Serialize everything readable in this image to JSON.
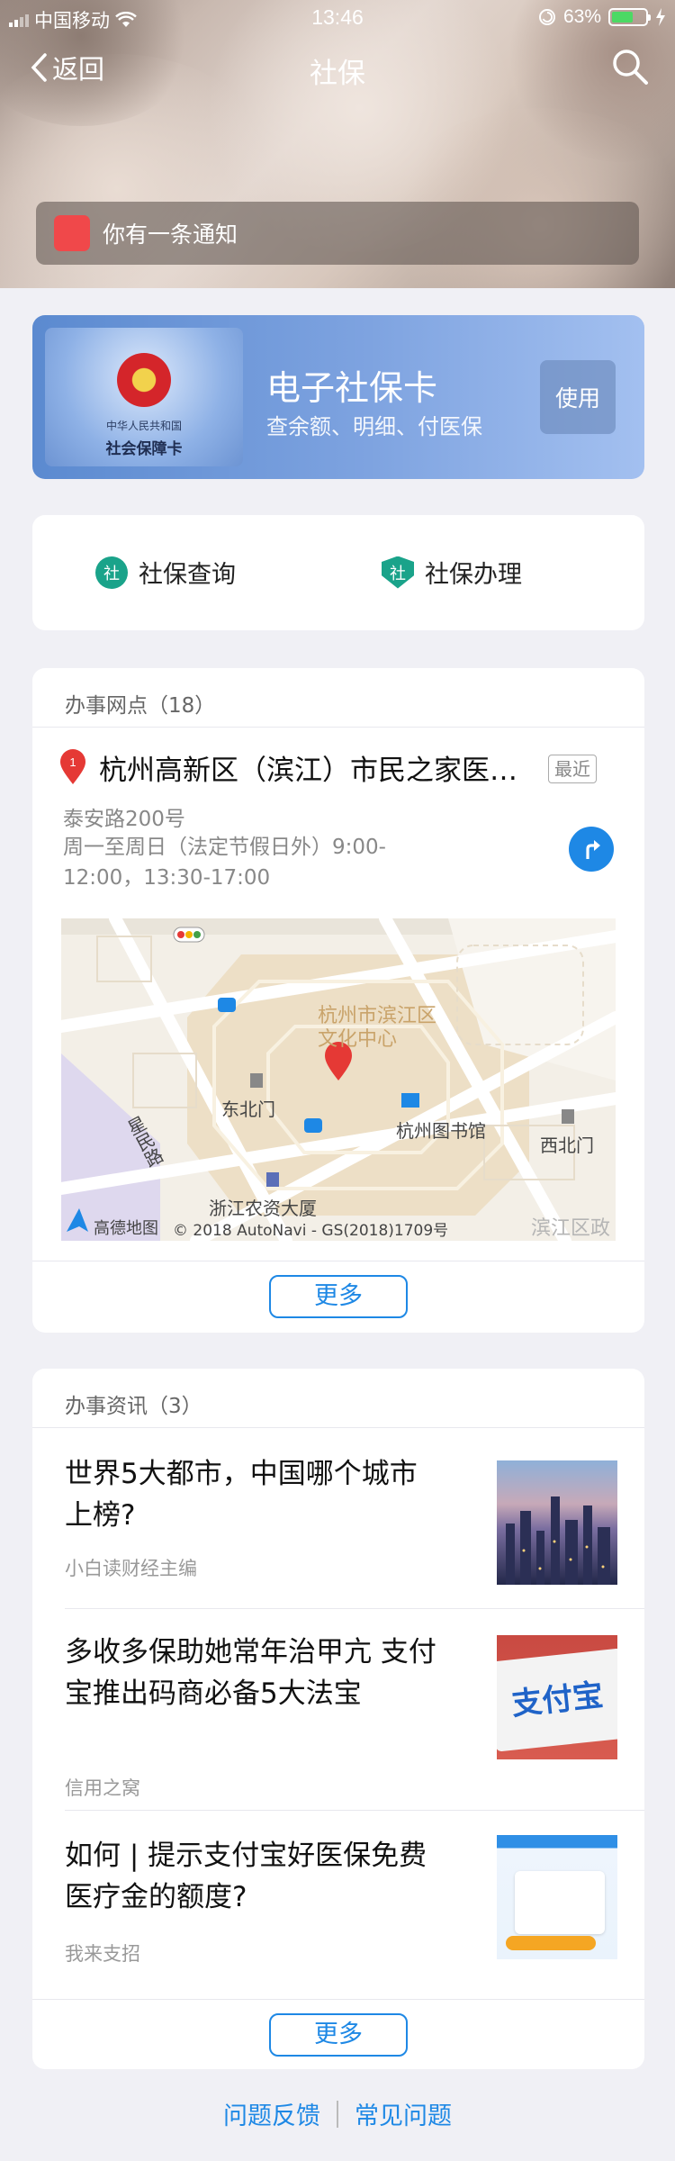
{
  "status_bar": {
    "carrier": "中国移动",
    "time": "13:46",
    "battery": "63%"
  },
  "nav": {
    "back_label": "返回",
    "title": "社保"
  },
  "notification": {
    "text": "你有一条通知"
  },
  "ecard": {
    "title": "电子社保卡",
    "subtitle": "查余额、明细、付医保",
    "button": "使用",
    "card_line1": "中华人民共和国",
    "card_line2": "社会保障卡"
  },
  "services": [
    {
      "icon_glyph": "社",
      "label": "社保查询"
    },
    {
      "icon_glyph": "社",
      "label": "社保办理"
    }
  ],
  "offices": {
    "header": "办事网点（18）",
    "marker_number": "1",
    "name": "杭州高新区（滨江）市民之家医…",
    "badge": "最近",
    "address": "泰安路200号",
    "hours": "周一至周日（法定节假日外）9:00-12:00，13:30-17:00",
    "map_labels": {
      "center": "杭州市滨江区文化中心",
      "road": "星民路",
      "east_gate": "东北门",
      "library": "杭州图书馆",
      "west_gate": "西北门",
      "building": "浙江农资大厦",
      "district": "滨江区政",
      "credit": "© 2018 AutoNavi - GS(2018)1709号",
      "brand": "高德地图"
    },
    "more_button": "更多"
  },
  "news": {
    "header": "办事资讯（3）",
    "items": [
      {
        "title": "世界5大都市，中国哪个城市上榜?",
        "source": "小白读财经主编"
      },
      {
        "title": "多收多保助她常年治甲亢 支付宝推出码商必备5大法宝",
        "source": "信用之窝"
      },
      {
        "title": "如何 | 提示支付宝好医保免费医疗金的额度?",
        "source": "我来支招"
      }
    ],
    "img2_text": "支付宝",
    "more_button": "更多"
  },
  "footer_links": {
    "feedback": "问题反馈",
    "faq": "常见问题"
  },
  "colors": {
    "accent": "#1e88e5",
    "service_green": "#1aa38a",
    "marker_red": "#e53935"
  },
  "icons": [
    "signal-icon",
    "wifi-icon",
    "location-lock-icon",
    "battery-icon",
    "charging-icon",
    "back-chevron-icon",
    "search-icon",
    "notification-dot-icon",
    "map-pin-icon",
    "navigate-icon"
  ]
}
